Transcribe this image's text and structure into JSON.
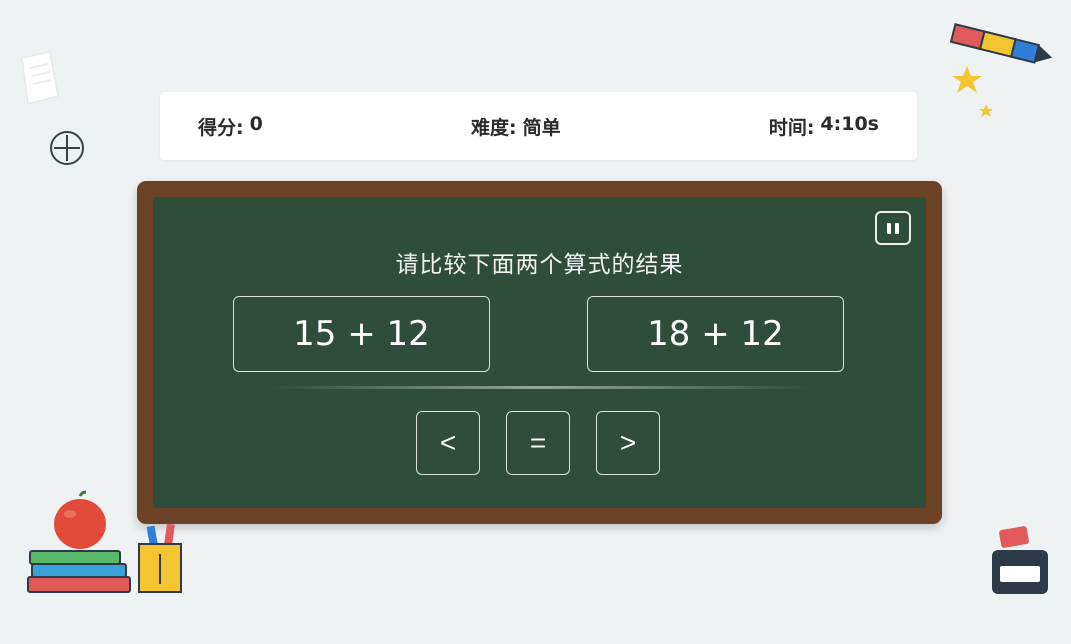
{
  "status": {
    "score_label": "得分:",
    "score_value": "0",
    "difficulty_label": "难度:",
    "difficulty_value": "简单",
    "time_label": "时间:",
    "time_value": "4:10s"
  },
  "board": {
    "question": "请比较下面两个算式的结果",
    "left_expression": "15 + 12",
    "right_expression": "18 + 12",
    "answers": [
      "<",
      "=",
      ">"
    ]
  },
  "icons": {
    "pause": "pause-icon",
    "add": "plus-circle-icon",
    "pencil": "pencil-icon",
    "stars": "star-icon",
    "apple": "apple-icon",
    "books": "books-icon",
    "pen_holder": "pencil-cup-icon",
    "pencil_case": "pencil-case-icon",
    "paper": "paper-icon"
  },
  "colors": {
    "background": "#eef2f2",
    "board": "#2f4d3b",
    "frame": "#6b4226",
    "text_dark": "#2b2b2b"
  }
}
